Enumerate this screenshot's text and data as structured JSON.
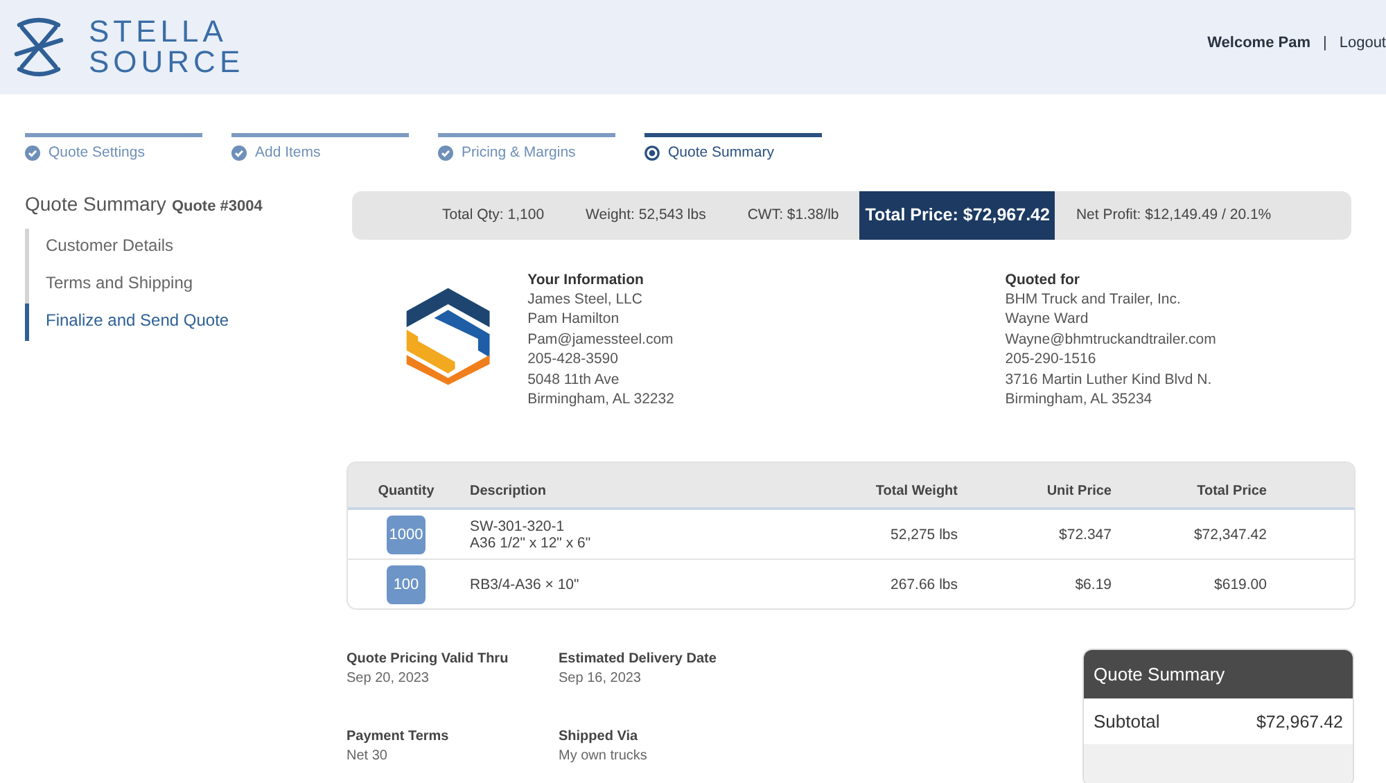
{
  "brand": {
    "line_1": "STELLA",
    "line_2": "SOURCE"
  },
  "user": {
    "welcome": "Welcome Pam",
    "separator": "|",
    "logout": "Logout"
  },
  "steps": [
    {
      "label": "Quote Settings",
      "selected": false
    },
    {
      "label": "Add Items",
      "selected": false
    },
    {
      "label": "Pricing & Margins",
      "selected": false
    },
    {
      "label": "Quote Summary",
      "selected": true
    }
  ],
  "page_title": {
    "title": "Quote Summary",
    "quote_number": "Quote #3004"
  },
  "sidebar": {
    "items": [
      {
        "label": "Customer Details",
        "selected": false
      },
      {
        "label": "Terms and Shipping",
        "selected": false
      },
      {
        "label": "Finalize and Send Quote",
        "selected": true
      }
    ]
  },
  "stats": [
    {
      "text": "Total Qty: 1,100",
      "highlighted": false
    },
    {
      "text": "Weight: 52,543 lbs",
      "highlighted": false
    },
    {
      "text": "CWT: $1.38/lb",
      "highlighted": false
    },
    {
      "text": "Total Price: $72,967.42",
      "highlighted": true
    },
    {
      "text": "Net Profit: $12,149.49 / 20.1%",
      "highlighted": false
    }
  ],
  "your_information": {
    "heading": "Your Information",
    "lines": [
      "James Steel, LLC",
      "Pam Hamilton",
      "Pam@jamessteel.com",
      "205-428-3590",
      "5048 11th Ave",
      "Birmingham, AL 32232"
    ]
  },
  "quoted_for": {
    "heading": "Quoted for",
    "lines": [
      "BHM Truck and Trailer, Inc.",
      "Wayne Ward",
      "Wayne@bhmtruckandtrailer.com",
      "205-290-1516",
      "3716 Martin Luther Kind Blvd N.",
      "Birmingham, AL 35234"
    ]
  },
  "table": {
    "columns": [
      "Quantity",
      "Description",
      "Total Weight",
      "Unit Price",
      "Total Price"
    ],
    "rows": [
      {
        "quantity": "1000",
        "description": [
          "SW-301-320-1",
          "A36 1/2\" x 12\" x 6\""
        ],
        "total_weight": "52,275 lbs",
        "unit_price": "$72.347",
        "total_price": "$72,347.42"
      },
      {
        "quantity": "100",
        "description": [
          "RB3/4-A36 × 10\""
        ],
        "total_weight": "267.66 lbs",
        "unit_price": "$6.19",
        "total_price": "$619.00"
      }
    ]
  },
  "terms": [
    {
      "label": "Quote Pricing Valid Thru",
      "value": "Sep 20, 2023"
    },
    {
      "label": "Estimated Delivery Date",
      "value": "Sep 16, 2023"
    },
    {
      "label": "Payment Terms",
      "value": "Net 30"
    },
    {
      "label": "Shipped Via",
      "value": "My own trucks"
    }
  ],
  "summary_card": {
    "title": "Quote Summary",
    "rows": [
      {
        "label": "Subtotal",
        "value": "$72,967.42"
      }
    ]
  }
}
